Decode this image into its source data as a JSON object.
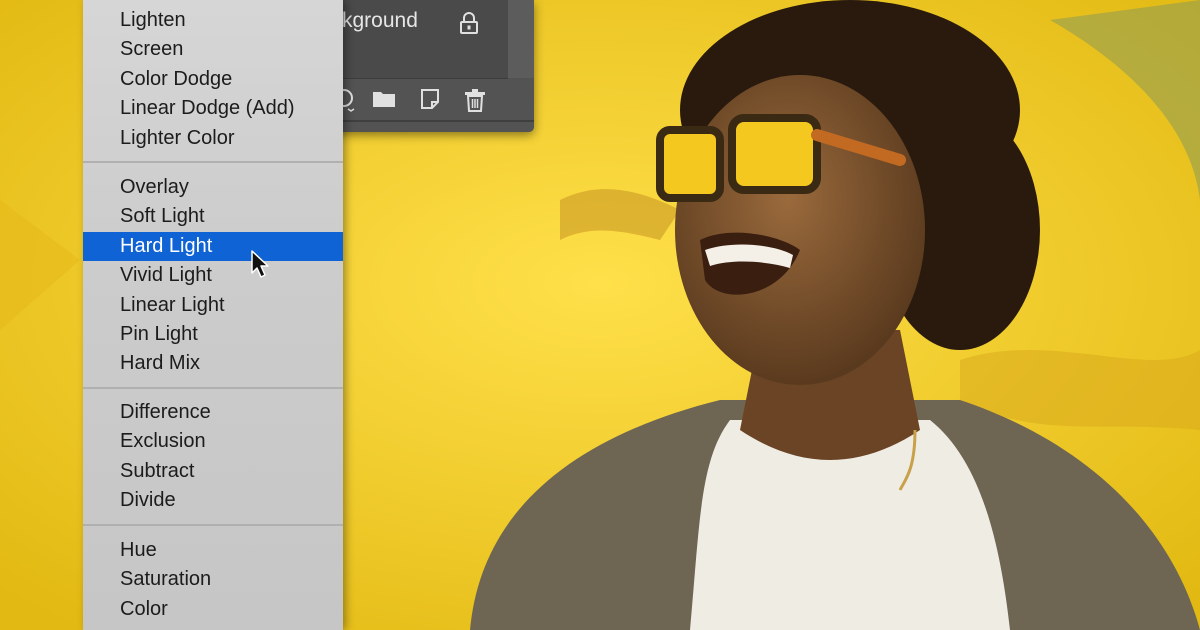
{
  "layers_panel": {
    "layer_name": "kground",
    "icons": [
      "lock-icon",
      "adjustment-layer-icon",
      "group-folder-icon",
      "new-layer-icon",
      "trash-icon"
    ]
  },
  "blend_menu": {
    "groups": [
      [
        "Lighten",
        "Screen",
        "Color Dodge",
        "Linear Dodge (Add)",
        "Lighter Color"
      ],
      [
        "Overlay",
        "Soft Light",
        "Hard Light",
        "Vivid Light",
        "Linear Light",
        "Pin Light",
        "Hard Mix"
      ],
      [
        "Difference",
        "Exclusion",
        "Subtract",
        "Divide"
      ],
      [
        "Hue",
        "Saturation",
        "Color"
      ]
    ],
    "selected": "Hard Light",
    "selection_color": "#0f63d4"
  },
  "colors": {
    "background_yellow": "#f1cd2c",
    "panel_dark": "#535353",
    "menu_bg": "#cccccc"
  }
}
